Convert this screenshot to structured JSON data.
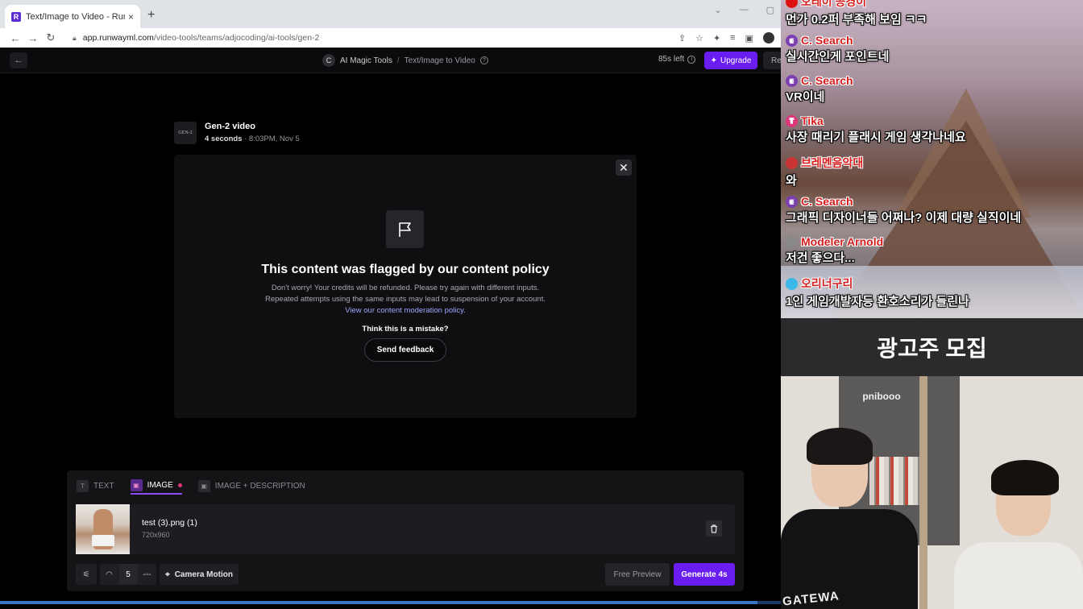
{
  "browser": {
    "tab_title": "Text/Image to Video - Runway",
    "favicon_letter": "R",
    "tab_close": "×",
    "new_tab": "+",
    "url_host": "app.runwayml.com",
    "url_path": "/video-tools/teams/adjocoding/ai-tools/gen-2"
  },
  "header": {
    "back": "←",
    "workspace_initial": "C",
    "crumb_tool": "AI Magic Tools",
    "crumb_sep": "/",
    "crumb_page": "Text/Image to Video",
    "credits_left": "85s left",
    "upgrade_label": "Upgrade",
    "reset_label": "Rese"
  },
  "generation": {
    "thumb_label": "GEN-2",
    "title": "Gen-2 video",
    "duration": "4 seconds",
    "meta": " · 8:03PM, Nov 5"
  },
  "flag": {
    "heading": "This content was flagged by our content policy",
    "body": "Don't worry! Your credits will be refunded. Please try again with different inputs. Repeated attempts using the same inputs may lead to suspension of your account. ",
    "link": "View our content moderation policy.",
    "mistake": "Think this is a mistake?",
    "feedback_label": "Send feedback"
  },
  "panel": {
    "tabs": [
      {
        "label": "TEXT",
        "icon": "T"
      },
      {
        "label": "IMAGE",
        "icon": "▣"
      },
      {
        "label": "IMAGE + DESCRIPTION",
        "icon": "▣"
      }
    ],
    "active_tab": "IMAGE",
    "file_name": "test (3).png (1)",
    "file_dims": "720x960",
    "motion_value": "5",
    "camera_motion_label": "Camera Motion",
    "free_preview_label": "Free Preview",
    "generate_label": "Generate 4s"
  },
  "chat": [
    {
      "user": "오레이 공경이",
      "text": "먼가 0.2퍼 부족해 보임 ㅋㅋ",
      "color": "#d61c1c",
      "avatar_color": "#d11"
    },
    {
      "user": "C. Search",
      "text": "실시간인게 포인트네",
      "color": "#d61c1c",
      "avatar_color": "#7b3fb0"
    },
    {
      "user": "C. Search",
      "text": "VR이네",
      "color": "#d61c1c",
      "avatar_color": "#7b3fb0"
    },
    {
      "user": "Tika",
      "text": "사장 때리기 플래시 게임 생각나네요",
      "color": "#d61c1c",
      "avatar_color": "#e0357a"
    },
    {
      "user": "브레멘음악대",
      "text": "와",
      "color": "#d61c1c",
      "avatar_color": "#c33"
    },
    {
      "user": "C. Search",
      "text": "그래픽 디자이너들 어쩌나? 이제 대량 실직이네",
      "color": "#d61c1c",
      "avatar_color": "#7b3fb0"
    },
    {
      "user": "Modeler Arnold",
      "text": "저건 좋으다...",
      "color": "#d61c1c",
      "avatar_color": "#888"
    },
    {
      "user": "오리너구리",
      "text": "1인 게임개발자등 환호소리가 들린나",
      "color": "#d61c1c",
      "avatar_color": "#3bb8e8"
    }
  ],
  "ad": {
    "text": "광고주 모집"
  },
  "cam": {
    "sign": "pnibooo",
    "shirt": "GATEWA"
  },
  "progress": {
    "fraction": 0.97
  }
}
